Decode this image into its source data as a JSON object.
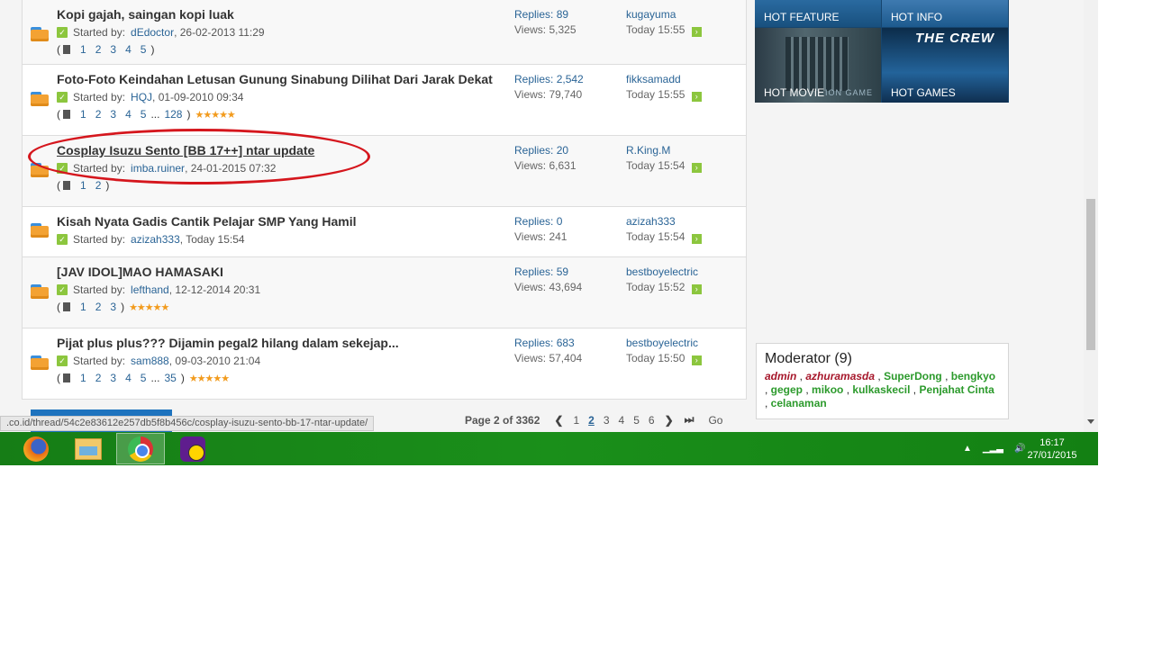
{
  "threads": [
    {
      "title": "Kopi gajah, saingan kopi luak",
      "started_label": "Started by:",
      "author": "dEdoctor",
      "date": ", 26-02-2013 11:29",
      "pages": [
        "1",
        "2",
        "3",
        "4",
        "5"
      ],
      "ellipsis": "",
      "last_page": "",
      "stars": "",
      "replies": "Replies: 89",
      "views": "Views: 5,325",
      "last_user": "kugayuma",
      "last_time": "Today 15:55"
    },
    {
      "title": "Foto-Foto Keindahan Letusan Gunung Sinabung Dilihat Dari Jarak Dekat",
      "started_label": "Started by:",
      "author": "HQJ",
      "date": ", 01-09-2010 09:34",
      "pages": [
        "1",
        "2",
        "3",
        "4",
        "5"
      ],
      "ellipsis": "...",
      "last_page": "128",
      "stars": "★★★★★",
      "replies": "Replies: 2,542",
      "views": "Views: 79,740",
      "last_user": "fikksamadd",
      "last_time": "Today 15:55"
    },
    {
      "title": "Cosplay Isuzu Sento [BB 17++] ntar update",
      "started_label": "Started by:",
      "author": "imba.ruiner",
      "date": ", 24-01-2015 07:32",
      "pages": [
        "1",
        "2"
      ],
      "ellipsis": "",
      "last_page": "",
      "stars": "",
      "replies": "Replies: 20",
      "views": "Views: 6,631",
      "last_user": "R.King.M",
      "last_time": "Today 15:54"
    },
    {
      "title": "Kisah Nyata Gadis Cantik Pelajar SMP Yang Hamil",
      "started_label": "Started by:",
      "author": "azizah333",
      "date": ", Today 15:54",
      "pages": [],
      "ellipsis": "",
      "last_page": "",
      "stars": "",
      "replies": "Replies: 0",
      "views": "Views: 241",
      "last_user": "azizah333",
      "last_time": "Today 15:54"
    },
    {
      "title": "[JAV IDOL]MAO HAMASAKI",
      "started_label": "Started by:",
      "author": "lefthand",
      "date": ", 12-12-2014 20:31",
      "pages": [
        "1",
        "2",
        "3"
      ],
      "ellipsis": "",
      "last_page": "",
      "stars": "★★★★★",
      "replies": "Replies: 59",
      "views": "Views: 43,694",
      "last_user": "bestboyelectric",
      "last_time": "Today 15:52"
    },
    {
      "title": "Pijat plus plus??? Dijamin pegal2 hilang dalam sekejap...",
      "started_label": "Started by:",
      "author": "sam888",
      "date": ", 09-03-2010 21:04",
      "pages": [
        "1",
        "2",
        "3",
        "4",
        "5"
      ],
      "ellipsis": "...",
      "last_page": "35",
      "stars": "★★★★★",
      "replies": "Replies: 683",
      "views": "Views: 57,404",
      "last_user": "bestboyelectric",
      "last_time": "Today 15:50"
    }
  ],
  "pagination": {
    "label": "Page 2 of 3362",
    "pages": [
      "1",
      "2",
      "3",
      "4",
      "5",
      "6"
    ],
    "current": "2",
    "go": "Go"
  },
  "status_url": ".co.id/thread/54c2e83612e257db5f8b456c/cosplay-isuzu-sento-bb-17-ntar-update/",
  "promos": {
    "feature": "HOT FEATURE",
    "info": "HOT INFO",
    "movie": "HOT MOVIE",
    "movie_tag": "ION GAME",
    "games": "HOT GAMES",
    "games_logo": "THE CREW"
  },
  "moderators": {
    "title": "Moderator (9)",
    "admins": [
      "admin",
      "azhuramasda"
    ],
    "mods": [
      "SuperDong",
      "bengkyo",
      "gegep",
      "mikoo",
      "kulkaskecil",
      "Penjahat Cinta",
      "celanaman"
    ]
  },
  "taskbar": {
    "apps": [
      "firefox",
      "file-explorer",
      "chrome",
      "yahoo-messenger"
    ],
    "active_app": "chrome",
    "time": "16:17",
    "date": "27/01/2015"
  },
  "colors": {
    "link": "#2a6496",
    "annotation": "#d5161d",
    "taskbar": "#1a8f1a",
    "admin": "#a6162a",
    "moderator": "#2c9a2c"
  }
}
